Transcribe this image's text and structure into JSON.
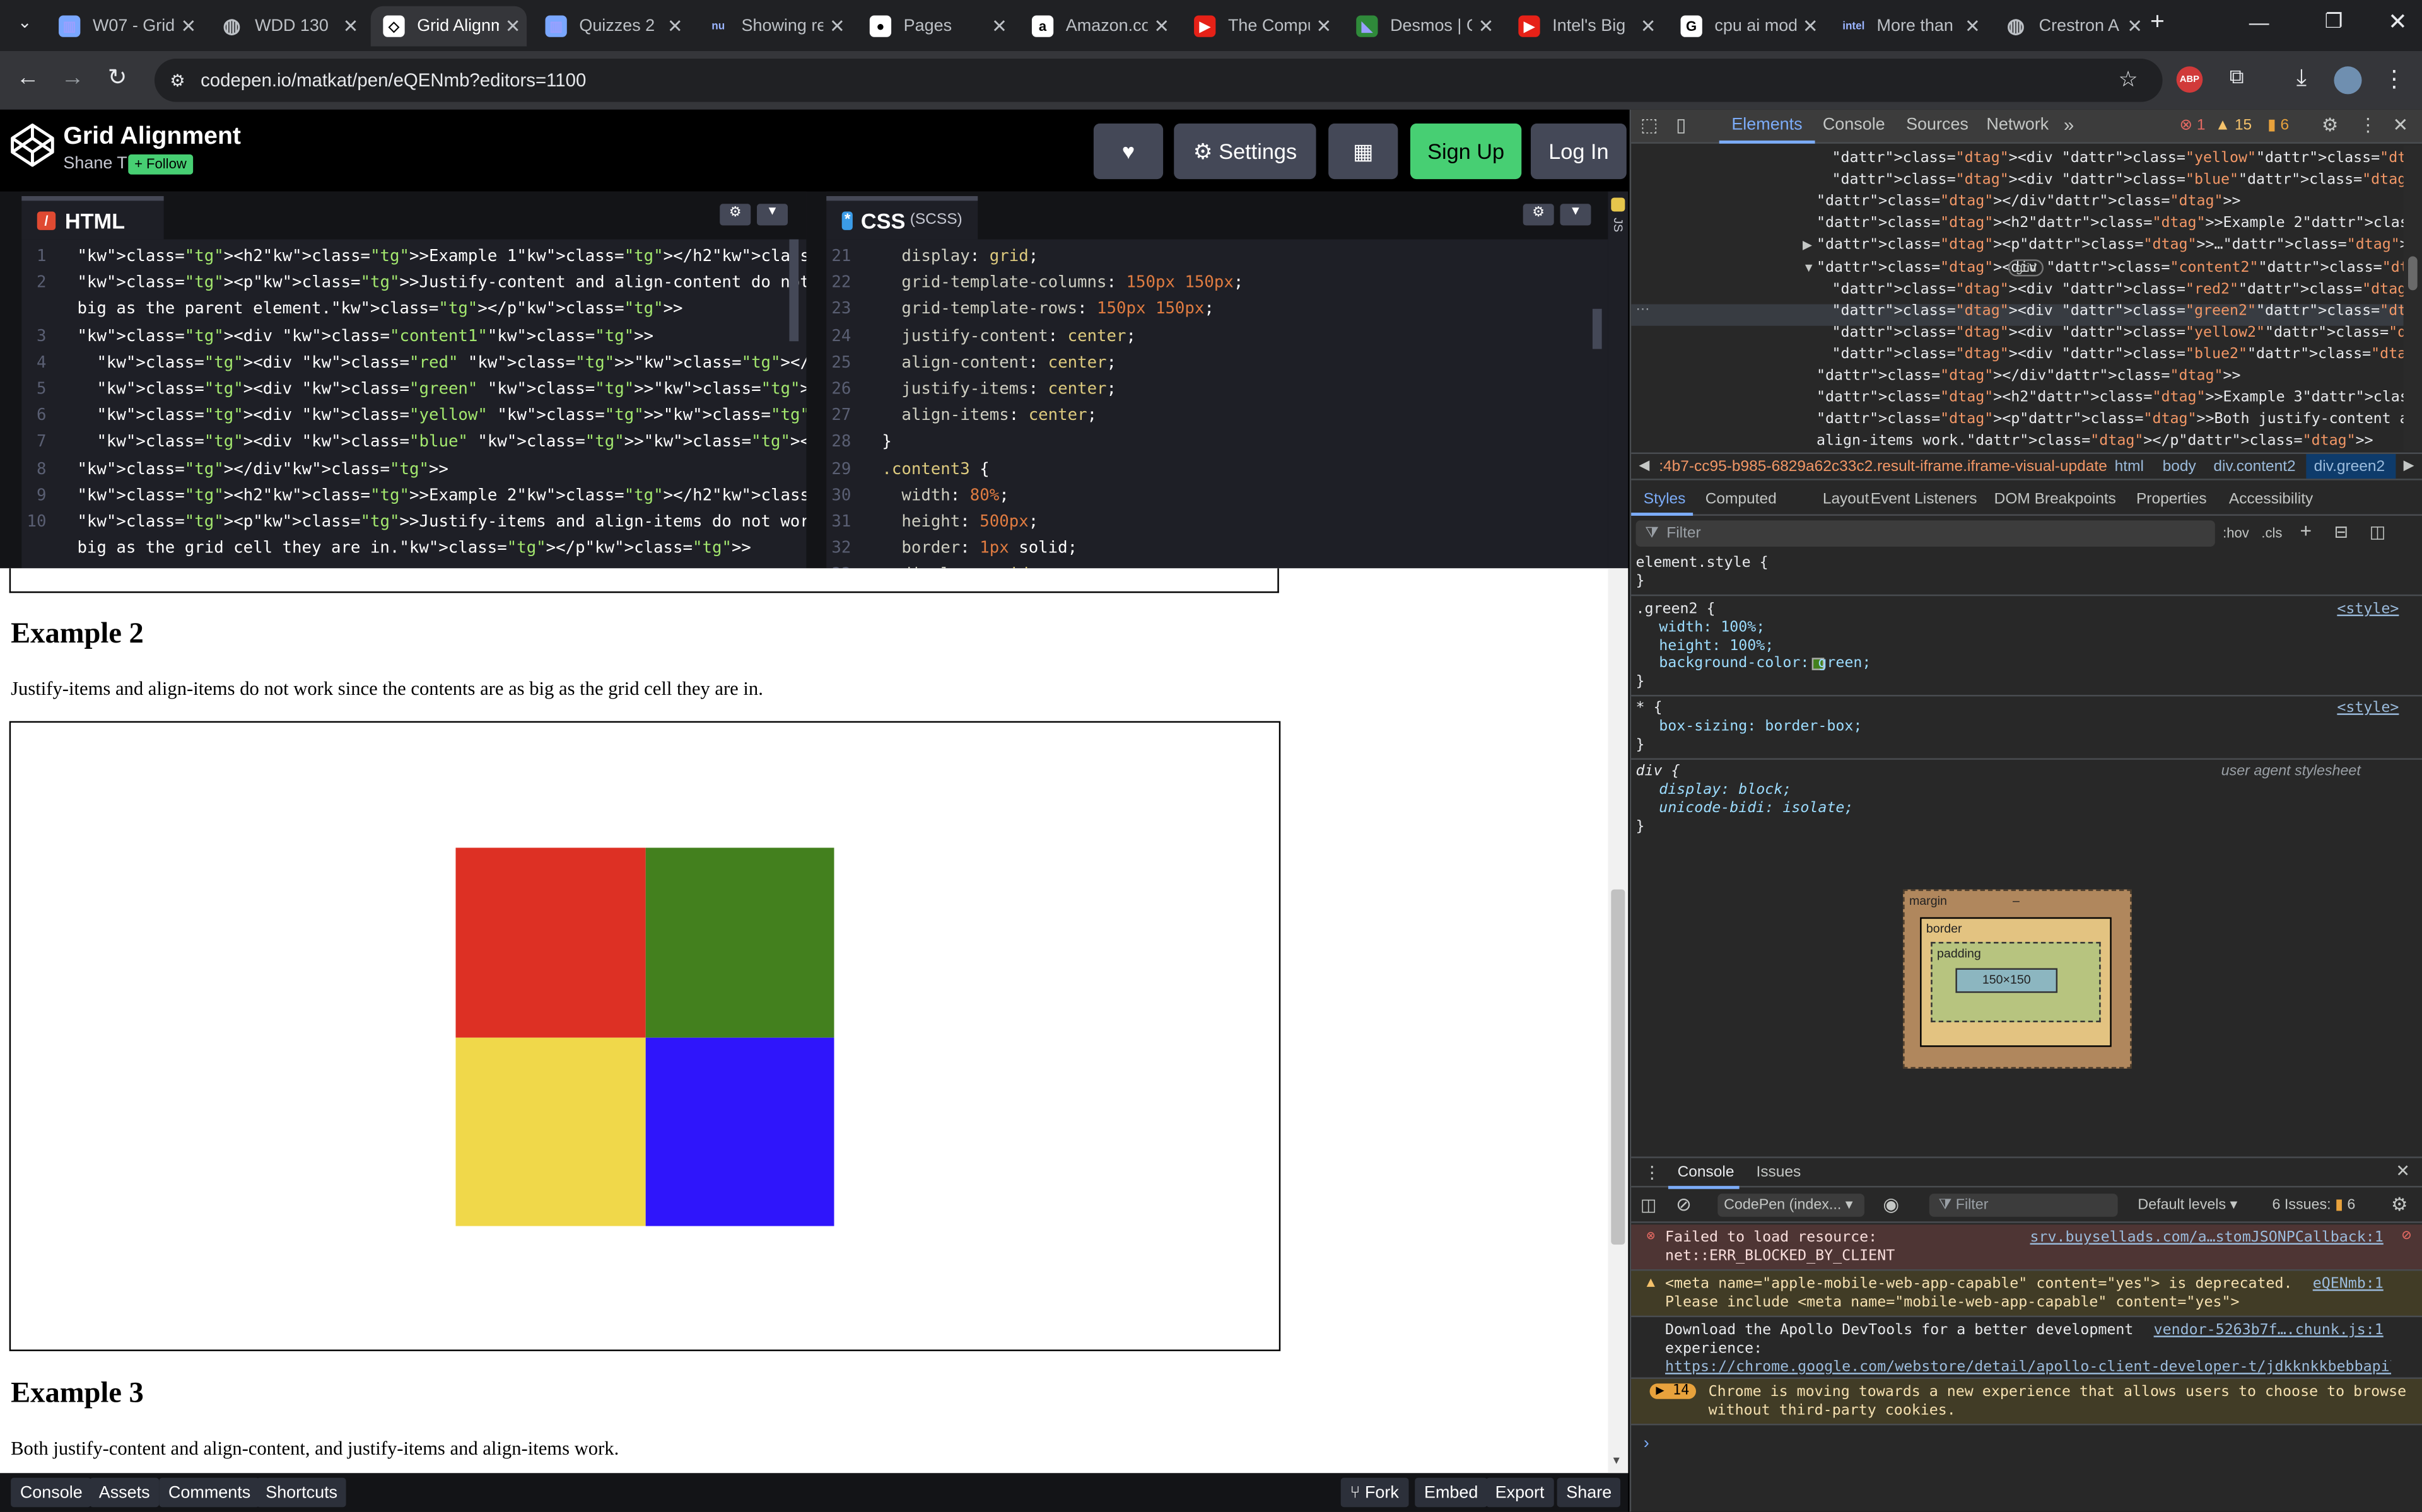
{
  "browser": {
    "tabs": [
      {
        "title": "W07 - Grid",
        "icon": "chart-icon",
        "active": false
      },
      {
        "title": "WDD 130",
        "icon": "globe-icon",
        "active": false
      },
      {
        "title": "Grid Alignment",
        "icon": "codepen-icon",
        "active": true
      },
      {
        "title": "Quizzes 2",
        "icon": "chart-icon",
        "active": false
      },
      {
        "title": "Showing results",
        "icon": "nu-icon",
        "active": false
      },
      {
        "title": "Pages",
        "icon": "github-icon",
        "active": false
      },
      {
        "title": "Amazon.com",
        "icon": "amazon-icon",
        "active": false
      },
      {
        "title": "The Computer",
        "icon": "youtube-icon",
        "active": false
      },
      {
        "title": "Desmos | Graphing",
        "icon": "desmos-icon",
        "active": false
      },
      {
        "title": "Intel's Big",
        "icon": "youtube-icon",
        "active": false
      },
      {
        "title": "cpu ai model",
        "icon": "google-icon",
        "active": false
      },
      {
        "title": "More than",
        "icon": "intel-icon",
        "active": false
      },
      {
        "title": "Crestron AI",
        "icon": "globe-icon",
        "active": false
      }
    ],
    "url": "codepen.io/matkat/pen/eQENmb?editors=1100"
  },
  "codepen": {
    "title": "Grid Alignment",
    "author": "Shane T",
    "follow_label": "+ Follow",
    "settings_label": "Settings",
    "signup_label": "Sign Up",
    "login_label": "Log In",
    "html_tab": "HTML",
    "css_tab": "CSS",
    "css_sub": "(SCSS)",
    "js_tab": "JS",
    "html_lines": [
      {
        "n": "1",
        "t": "<h2>Example 1</h2>"
      },
      {
        "n": "2",
        "t": "<p>Justify-content and align-content do not work since the grid is as"
      },
      {
        "n": "",
        "t": "big as the parent element.</p>"
      },
      {
        "n": "3",
        "t": "<div class=\"content1\">"
      },
      {
        "n": "4",
        "t": "  <div class=\"red\" ></div>"
      },
      {
        "n": "5",
        "t": "  <div class=\"green\" ></div>"
      },
      {
        "n": "6",
        "t": "  <div class=\"yellow\" ></div>"
      },
      {
        "n": "7",
        "t": "  <div class=\"blue\" ></div>"
      },
      {
        "n": "8",
        "t": "</div>"
      },
      {
        "n": "9",
        "t": "<h2>Example 2</h2>"
      },
      {
        "n": "10",
        "t": "<p>Justify-items and align-items do not work since the contents are as"
      },
      {
        "n": "",
        "t": "big as the grid cell they are in.</p>"
      }
    ],
    "css_lines": [
      {
        "n": "21",
        "t": "  display: grid;"
      },
      {
        "n": "22",
        "t": "  grid-template-columns: 150px 150px;"
      },
      {
        "n": "23",
        "t": "  grid-template-rows: 150px 150px;"
      },
      {
        "n": "24",
        "t": "  justify-content: center;"
      },
      {
        "n": "25",
        "t": "  align-content: center;"
      },
      {
        "n": "26",
        "t": "  justify-items: center;"
      },
      {
        "n": "27",
        "t": "  align-items: center;"
      },
      {
        "n": "28",
        "t": "}"
      },
      {
        "n": "29",
        "t": ".content3 {"
      },
      {
        "n": "30",
        "t": "  width: 80%;"
      },
      {
        "n": "31",
        "t": "  height: 500px;"
      },
      {
        "n": "32",
        "t": "  border: 1px solid;"
      },
      {
        "n": "33",
        "t": "  display: grid;"
      }
    ],
    "footer": {
      "console": "Console",
      "assets": "Assets",
      "comments": "Comments",
      "shortcuts": "Shortcuts",
      "fork": "Fork",
      "embed": "Embed",
      "export": "Export",
      "share": "Share"
    }
  },
  "preview": {
    "example2_title": "Example 2",
    "example2_text": "Justify-items and align-items do not work since the contents are as big as the grid cell they are in.",
    "example3_title": "Example 3",
    "example3_text": "Both justify-content and align-content, and justify-items and align-items work.",
    "cell_colors": {
      "red": "#dd3024",
      "green": "#43801e",
      "yellow": "#f0d84a",
      "blue": "#2f15fb"
    }
  },
  "devtools": {
    "tabs": [
      "Elements",
      "Console",
      "Sources",
      "Network"
    ],
    "errors": "1",
    "warnings": "15",
    "issues": "6",
    "dom_lines": [
      "<div class=\"yellow\"></div>",
      "<div class=\"blue\"></div>",
      "</div>",
      "<h2>Example 2</h2>",
      "<p>…</p>",
      "<div class=\"content2\">",
      "<div class=\"red2\"></div>",
      "<div class=\"green2\"></div> == $0",
      "<div class=\"yellow2\"></div>",
      "<div class=\"blue2\"></div>",
      "</div>",
      "<h2>Example 3</h2>",
      "<p>Both justify-content and align-content, and justify-items and",
      "align-items work.</p>"
    ],
    "grid_badge": "grid",
    "breadcrumb": [
      ":4b7-cc95-b985-6829a62c33c2.result-iframe.iframe-visual-update",
      "html",
      "body",
      "div.content2",
      "div.green2"
    ],
    "style_tabs": [
      "Styles",
      "Computed",
      "Layout",
      "Event Listeners",
      "DOM Breakpoints",
      "Properties",
      "Accessibility"
    ],
    "filter_placeholder": "Filter",
    "hov": ":hov",
    "cls": ".cls",
    "rules": [
      {
        "selector": "element.style {",
        "source": "",
        "props": []
      },
      {
        "selector": ".green2 {",
        "source": "<style>",
        "props": [
          "width: 100%;",
          "height: 100%;",
          "background-color: green;"
        ]
      },
      {
        "selector": "* {",
        "source": "<style>",
        "props": [
          "box-sizing: border-box;"
        ]
      },
      {
        "selector": "div {",
        "source": "user agent stylesheet",
        "props": [
          "display: block;",
          "unicode-bidi: isolate;"
        ]
      }
    ],
    "box_model": {
      "margin": "margin",
      "border": "border",
      "padding": "padding",
      "content": "150×150",
      "dash": "–"
    },
    "drawer_tabs": [
      "Console",
      "Issues"
    ],
    "console_context": "CodePen (index...",
    "console_filter": "Filter",
    "default_levels": "Default levels",
    "issues_label": "6 Issues:",
    "issues_count": "6",
    "messages": [
      {
        "type": "error",
        "text": "Failed to load resource:\nnet::ERR_BLOCKED_BY_CLIENT",
        "link": "srv.buysellads.com/a…stomJSONPCallback:1"
      },
      {
        "type": "warning",
        "text": "<meta name=\"apple-mobile-web-app-capable\" content=\"yes\"> is deprecated.\nPlease include <meta name=\"mobile-web-app-capable\" content=\"yes\">",
        "link": "eQENmb:1"
      },
      {
        "type": "info",
        "text": "Download the Apollo DevTools for a better development\nexperience:",
        "link": "vendor-5263b7f….chunk.js:1",
        "url": "https://chrome.google.com/webstore/detail/apollo-client-developer-t/jdkknkkbebbapilgoe…"
      },
      {
        "type": "grouped",
        "count": "14",
        "text": "Chrome is moving towards a new experience that allows users to choose to browse\nwithout third-party cookies."
      }
    ],
    "prompt": "›"
  }
}
